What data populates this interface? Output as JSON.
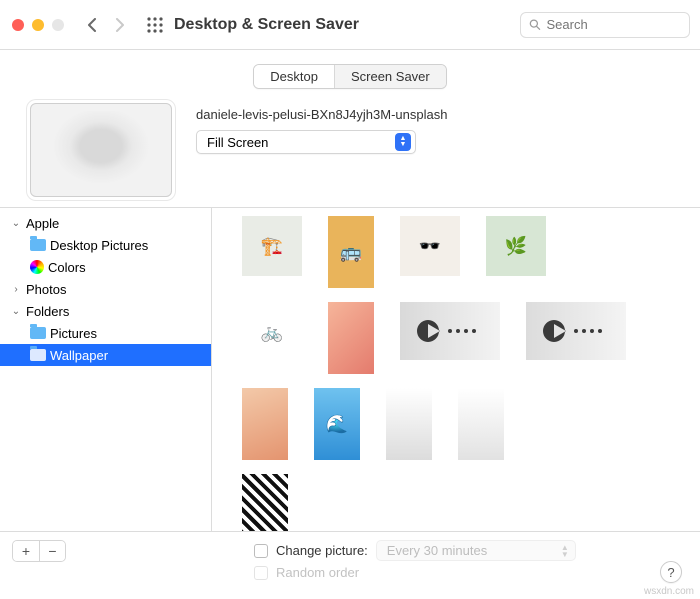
{
  "header": {
    "title": "Desktop & Screen Saver",
    "search_placeholder": "Search"
  },
  "tabs": {
    "desktop": "Desktop",
    "screensaver": "Screen Saver",
    "active": "desktop"
  },
  "current": {
    "filename": "daniele-levis-pelusi-BXn8J4yjh3M-unsplash",
    "fit_mode": "Fill Screen"
  },
  "sidebar": {
    "apple": "Apple",
    "desktop_pictures": "Desktop Pictures",
    "colors": "Colors",
    "photos": "Photos",
    "folders": "Folders",
    "pictures": "Pictures",
    "wallpaper": "Wallpaper"
  },
  "footer": {
    "change_picture": "Change picture:",
    "interval": "Every 30 minutes",
    "random": "Random order",
    "add": "+",
    "remove": "−",
    "help": "?"
  },
  "watermark": "wsxdn.com"
}
